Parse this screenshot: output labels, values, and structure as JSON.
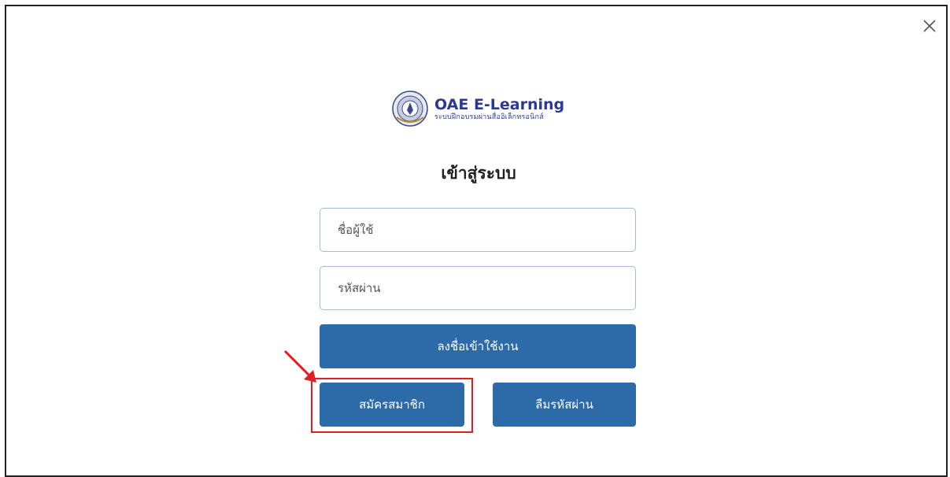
{
  "brand": {
    "title": "OAE E-Learning",
    "subtitle": "ระบบฝึกอบรมผ่านสื่ออิเล็กทรอนิกส์",
    "logo_icon": "oae-seal-icon",
    "color": "#2b3990"
  },
  "login": {
    "heading": "เข้าสู่ระบบ",
    "username_placeholder": "ชื่อผู้ใช้",
    "username_value": "",
    "password_placeholder": "รหัสผ่าน",
    "password_value": "",
    "submit_label": "ลงชื่อเข้าใช้งาน",
    "register_label": "สมัครสมาชิก",
    "forgot_label": "ลืมรหัสผ่าน"
  },
  "colors": {
    "button": "#2d6aa8",
    "input_border": "#9fbde0",
    "annotation": "#e02020"
  },
  "icons": {
    "close": "close-icon",
    "annotation_arrow": "arrow-icon"
  }
}
